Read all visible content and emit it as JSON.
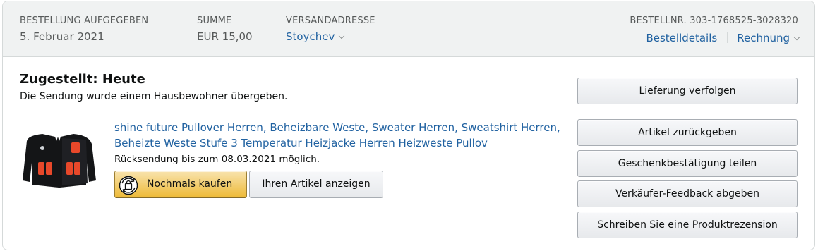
{
  "order": {
    "placed_label": "BESTELLUNG AUFGEGEBEN",
    "placed_value": "5. Februar 2021",
    "total_label": "SUMME",
    "total_value": "EUR 15,00",
    "ship_label": "VERSANDADRESSE",
    "ship_value": "Stoychev",
    "order_number": "BESTELLNR. 303-1768525-3028320",
    "details_link": "Bestelldetails",
    "invoice_link": "Rechnung"
  },
  "shipment": {
    "status": "Zugestellt: Heute",
    "substatus": "Die Sendung wurde einem Hausbewohner übergeben."
  },
  "item": {
    "title_line1": "shine future Pullover Herren, Beheizbare Weste, Sweater Herren, Sweatshirt Herren,",
    "title_line2": "Beheizte Weste Stufe 3 Temperatur Heizjacke Herren Heizweste Pullov",
    "return_note": "Rücksendung bis zum 08.03.2021 möglich.",
    "buy_again": "Nochmals kaufen",
    "view_item": "Ihren Artikel anzeigen"
  },
  "actions": {
    "track": "Lieferung verfolgen",
    "return": "Artikel zurückgeben",
    "gift": "Geschenkbestätigung teilen",
    "feedback": "Verkäufer-Feedback abgeben",
    "review": "Schreiben Sie eine Produktrezension"
  },
  "icons": {
    "buy_again": "buy-again-icon",
    "chevron": "chevron-down-icon",
    "thumbnail": "heated-sweater-thumbnail"
  },
  "colors": {
    "link": "#2162a1",
    "header_bg": "#f0f2f2",
    "heat_pad": "#e8482a"
  }
}
